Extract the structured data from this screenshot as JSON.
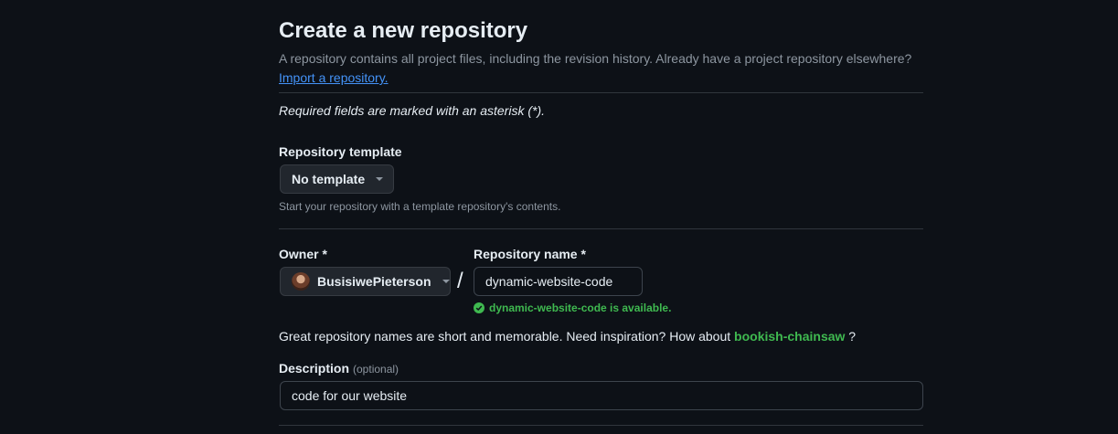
{
  "header": {
    "title": "Create a new repository",
    "subtitle": "A repository contains all project files, including the revision history. Already have a project repository elsewhere?",
    "import_link": "Import a repository."
  },
  "form": {
    "required_note": "Required fields are marked with an asterisk (*).",
    "template": {
      "label": "Repository template",
      "selected": "No template",
      "note": "Start your repository with a template repository's contents."
    },
    "owner": {
      "label": "Owner *",
      "selected": "BusisiwePieterson"
    },
    "separator": "/",
    "repo_name": {
      "label": "Repository name *",
      "value": "dynamic-website-code",
      "availability": "dynamic-website-code is available."
    },
    "inspiration": {
      "text": "Great repository names are short and memorable. Need inspiration? How about",
      "suggestion": "bookish-chainsaw",
      "end": "?"
    },
    "description": {
      "label": "Description",
      "optional": "(optional)",
      "value": "code for our website"
    }
  },
  "colors": {
    "background": "#0d1117",
    "link": "#4493f8",
    "success": "#3fb950",
    "muted": "#8d96a0"
  }
}
